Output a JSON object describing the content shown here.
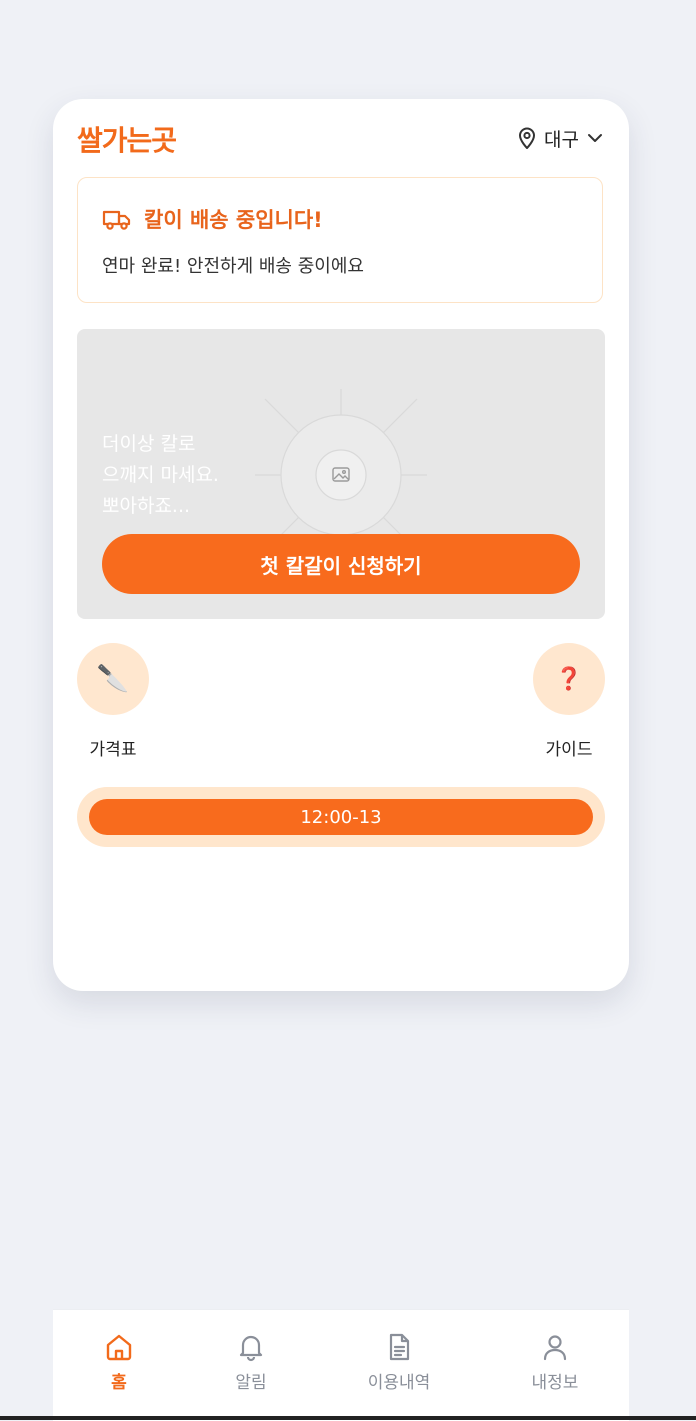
{
  "header": {
    "logo": "쌀가는곳",
    "location": "대구",
    "icons": {
      "location": "map-pin-icon",
      "dropdown": "chevron-down-icon"
    }
  },
  "banner": {
    "icon": "truck-icon",
    "title": "칼이 배송 중입니다!",
    "subtitle": "연마 완료! 안전하게 배송 중이에요"
  },
  "hero": {
    "text": "더이상 칼로\n으깨지 마세요.\n뽀아하죠...",
    "cta_label": "첫 칼갈이 신청하기",
    "image_icon": "image-placeholder-icon"
  },
  "quick_menu": [
    {
      "label": "가격표",
      "icon": "knife-icon",
      "glyph": "🔪"
    },
    {
      "label": "가이드",
      "icon": "question-icon",
      "glyph": "❓"
    }
  ],
  "time_slot": {
    "label": "12:00-13"
  },
  "bottom_nav": [
    {
      "label": "홈",
      "icon": "home-icon",
      "active": true
    },
    {
      "label": "알림",
      "icon": "bell-icon",
      "active": false
    },
    {
      "label": "이용내역",
      "icon": "document-icon",
      "active": false
    },
    {
      "label": "내정보",
      "icon": "user-icon",
      "active": false
    }
  ],
  "colors": {
    "accent": "#f86b1d",
    "accent_light": "#ffe6cc",
    "background": "#eff1f6"
  }
}
